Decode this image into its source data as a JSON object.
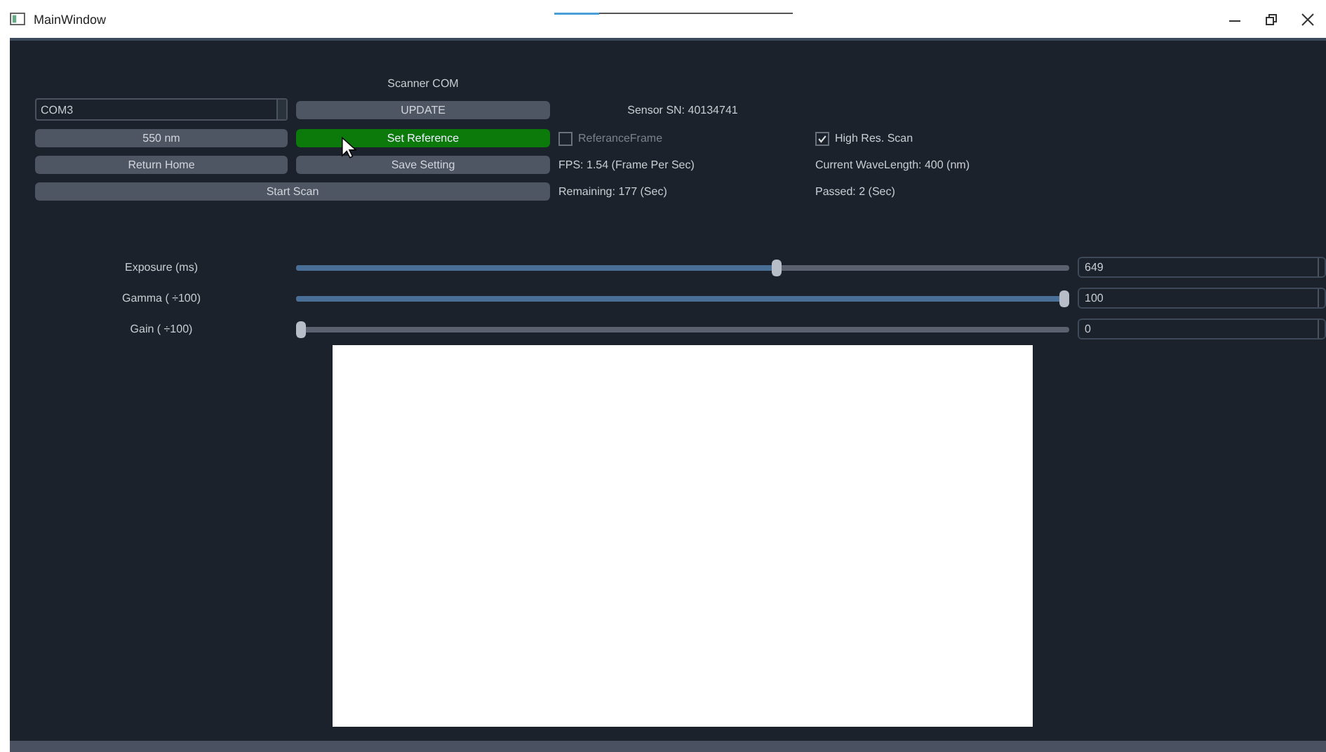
{
  "window": {
    "title": "MainWindow"
  },
  "scanner": {
    "com_label": "Scanner COM",
    "port": {
      "value": "COM3"
    },
    "sensor_sn": "Sensor SN: 40134741",
    "buttons": [
      {
        "label": "UPDATE",
        "highlighted": false
      },
      {
        "label": "550 nm",
        "highlighted": false
      },
      {
        "label": "Set Reference",
        "highlighted": true
      },
      {
        "label": "Return Home",
        "highlighted": false
      },
      {
        "label": "Save Setting",
        "highlighted": false
      },
      {
        "label": "Start Scan",
        "highlighted": false
      }
    ],
    "checkboxes": [
      {
        "label": "ReferanceFrame",
        "checked": false,
        "disabled": true
      },
      {
        "label": "High Res. Scan",
        "checked": true,
        "disabled": false
      }
    ],
    "info": [
      "FPS: 1.54 (Frame Per Sec)",
      "Current WaveLength: 400 (nm)",
      "Remaining: 177 (Sec)",
      "Passed: 2 (Sec)"
    ]
  },
  "sliders": [
    {
      "label": "Exposure (ms)",
      "level": 0.624,
      "value": "649"
    },
    {
      "label": "Gamma ( ÷100)",
      "level": 1,
      "value": "100"
    },
    {
      "label": "Gain ( ÷100)",
      "level": 0,
      "value": "0"
    }
  ]
}
